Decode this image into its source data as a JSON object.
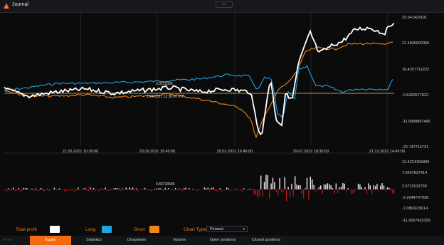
{
  "window": {
    "title": "Journal",
    "restore_label": "▭"
  },
  "main_chart": {
    "y_labels": [
      "32.541429191",
      "21.4836002066",
      "10.4257712222",
      "-0.6320577622",
      "-11.6898867466",
      "-22.747715731"
    ],
    "x_labels": [
      "21.05.2021 10:30:00",
      "20.09.2021 15:45:00",
      "25.01.2022 16:45:00",
      "29.07.2022 18:30:00",
      "21.12.2022 14:45:00"
    ],
    "annotations": [
      "3.0212385",
      "10/4/2021 12:30:00 PM"
    ],
    "colors": {
      "total": "#ffffff",
      "long": "#1fa5e0",
      "short": "#f08519",
      "grid": "#232428",
      "zero": "#f3c74c"
    }
  },
  "sub_chart": {
    "y_labels": [
      "12.4224155809",
      "7.5467837414",
      "2.6711519738",
      "-2.2044797938",
      "-7.0801115614",
      "-11.9557433329"
    ],
    "annotation": "0.83733589",
    "colors": {
      "pos": "#e8e8e8",
      "neg": "#b01418"
    }
  },
  "legend": {
    "total_profit": "Total profit",
    "long": "Long",
    "short": "Short",
    "chart_type_label": "Chart Type",
    "chart_type_value": "Persent",
    "colors": {
      "total": "#ffffff",
      "long": "#1fa5e0",
      "short": "#f08519"
    }
  },
  "tabs": {
    "more": "› › › ›",
    "items": [
      "Equity",
      "Statistics",
      "Drawdown",
      "Volume",
      "Open positions",
      "Closed positions"
    ],
    "active": "Equity"
  }
}
